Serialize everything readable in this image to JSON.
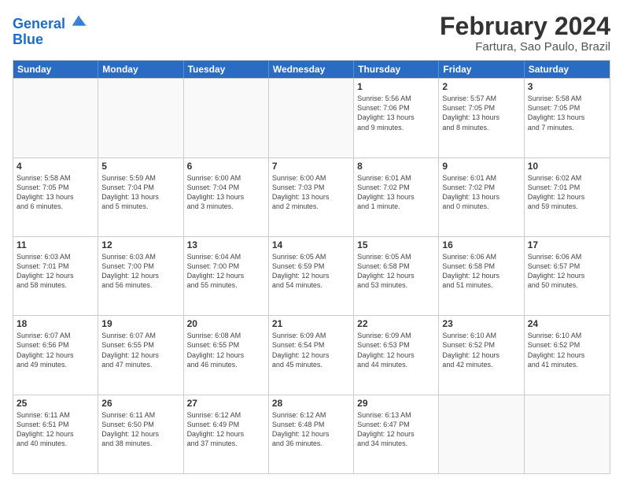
{
  "header": {
    "logo_line1": "General",
    "logo_line2": "Blue",
    "month_title": "February 2024",
    "location": "Fartura, Sao Paulo, Brazil"
  },
  "weekdays": [
    "Sunday",
    "Monday",
    "Tuesday",
    "Wednesday",
    "Thursday",
    "Friday",
    "Saturday"
  ],
  "rows": [
    [
      {
        "day": "",
        "info": ""
      },
      {
        "day": "",
        "info": ""
      },
      {
        "day": "",
        "info": ""
      },
      {
        "day": "",
        "info": ""
      },
      {
        "day": "1",
        "info": "Sunrise: 5:56 AM\nSunset: 7:06 PM\nDaylight: 13 hours\nand 9 minutes."
      },
      {
        "day": "2",
        "info": "Sunrise: 5:57 AM\nSunset: 7:05 PM\nDaylight: 13 hours\nand 8 minutes."
      },
      {
        "day": "3",
        "info": "Sunrise: 5:58 AM\nSunset: 7:05 PM\nDaylight: 13 hours\nand 7 minutes."
      }
    ],
    [
      {
        "day": "4",
        "info": "Sunrise: 5:58 AM\nSunset: 7:05 PM\nDaylight: 13 hours\nand 6 minutes."
      },
      {
        "day": "5",
        "info": "Sunrise: 5:59 AM\nSunset: 7:04 PM\nDaylight: 13 hours\nand 5 minutes."
      },
      {
        "day": "6",
        "info": "Sunrise: 6:00 AM\nSunset: 7:04 PM\nDaylight: 13 hours\nand 3 minutes."
      },
      {
        "day": "7",
        "info": "Sunrise: 6:00 AM\nSunset: 7:03 PM\nDaylight: 13 hours\nand 2 minutes."
      },
      {
        "day": "8",
        "info": "Sunrise: 6:01 AM\nSunset: 7:02 PM\nDaylight: 13 hours\nand 1 minute."
      },
      {
        "day": "9",
        "info": "Sunrise: 6:01 AM\nSunset: 7:02 PM\nDaylight: 13 hours\nand 0 minutes."
      },
      {
        "day": "10",
        "info": "Sunrise: 6:02 AM\nSunset: 7:01 PM\nDaylight: 12 hours\nand 59 minutes."
      }
    ],
    [
      {
        "day": "11",
        "info": "Sunrise: 6:03 AM\nSunset: 7:01 PM\nDaylight: 12 hours\nand 58 minutes."
      },
      {
        "day": "12",
        "info": "Sunrise: 6:03 AM\nSunset: 7:00 PM\nDaylight: 12 hours\nand 56 minutes."
      },
      {
        "day": "13",
        "info": "Sunrise: 6:04 AM\nSunset: 7:00 PM\nDaylight: 12 hours\nand 55 minutes."
      },
      {
        "day": "14",
        "info": "Sunrise: 6:05 AM\nSunset: 6:59 PM\nDaylight: 12 hours\nand 54 minutes."
      },
      {
        "day": "15",
        "info": "Sunrise: 6:05 AM\nSunset: 6:58 PM\nDaylight: 12 hours\nand 53 minutes."
      },
      {
        "day": "16",
        "info": "Sunrise: 6:06 AM\nSunset: 6:58 PM\nDaylight: 12 hours\nand 51 minutes."
      },
      {
        "day": "17",
        "info": "Sunrise: 6:06 AM\nSunset: 6:57 PM\nDaylight: 12 hours\nand 50 minutes."
      }
    ],
    [
      {
        "day": "18",
        "info": "Sunrise: 6:07 AM\nSunset: 6:56 PM\nDaylight: 12 hours\nand 49 minutes."
      },
      {
        "day": "19",
        "info": "Sunrise: 6:07 AM\nSunset: 6:55 PM\nDaylight: 12 hours\nand 47 minutes."
      },
      {
        "day": "20",
        "info": "Sunrise: 6:08 AM\nSunset: 6:55 PM\nDaylight: 12 hours\nand 46 minutes."
      },
      {
        "day": "21",
        "info": "Sunrise: 6:09 AM\nSunset: 6:54 PM\nDaylight: 12 hours\nand 45 minutes."
      },
      {
        "day": "22",
        "info": "Sunrise: 6:09 AM\nSunset: 6:53 PM\nDaylight: 12 hours\nand 44 minutes."
      },
      {
        "day": "23",
        "info": "Sunrise: 6:10 AM\nSunset: 6:52 PM\nDaylight: 12 hours\nand 42 minutes."
      },
      {
        "day": "24",
        "info": "Sunrise: 6:10 AM\nSunset: 6:52 PM\nDaylight: 12 hours\nand 41 minutes."
      }
    ],
    [
      {
        "day": "25",
        "info": "Sunrise: 6:11 AM\nSunset: 6:51 PM\nDaylight: 12 hours\nand 40 minutes."
      },
      {
        "day": "26",
        "info": "Sunrise: 6:11 AM\nSunset: 6:50 PM\nDaylight: 12 hours\nand 38 minutes."
      },
      {
        "day": "27",
        "info": "Sunrise: 6:12 AM\nSunset: 6:49 PM\nDaylight: 12 hours\nand 37 minutes."
      },
      {
        "day": "28",
        "info": "Sunrise: 6:12 AM\nSunset: 6:48 PM\nDaylight: 12 hours\nand 36 minutes."
      },
      {
        "day": "29",
        "info": "Sunrise: 6:13 AM\nSunset: 6:47 PM\nDaylight: 12 hours\nand 34 minutes."
      },
      {
        "day": "",
        "info": ""
      },
      {
        "day": "",
        "info": ""
      }
    ]
  ]
}
